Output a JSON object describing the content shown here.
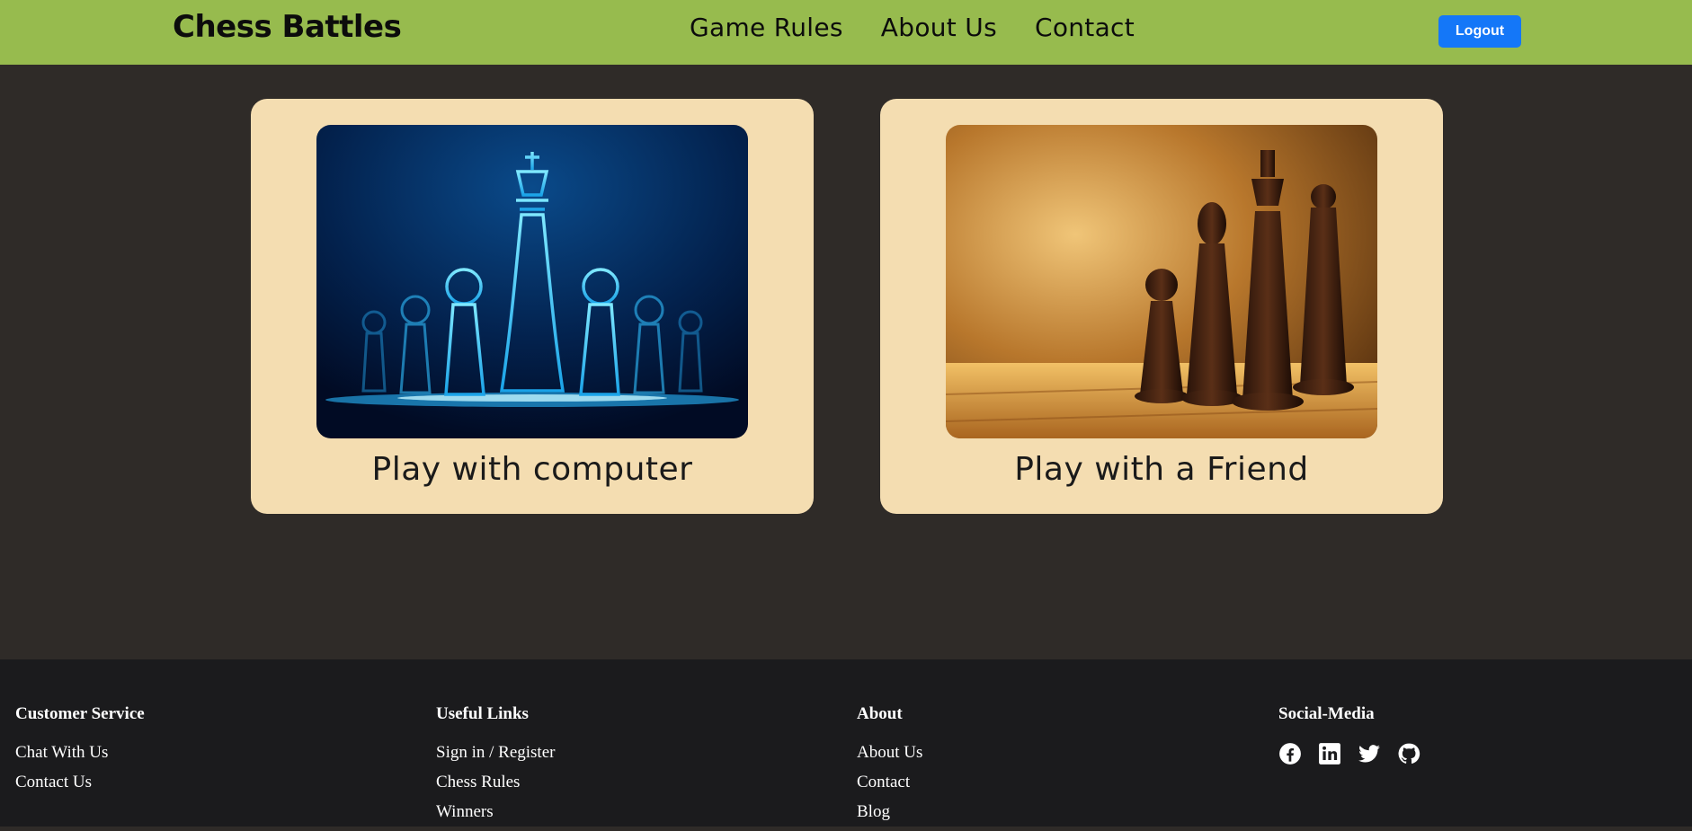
{
  "header": {
    "brand": "Chess Battles",
    "nav": [
      "Game Rules",
      "About Us",
      "Contact"
    ],
    "logout_label": "Logout"
  },
  "cards": [
    {
      "title": "Play with computer",
      "image": "glowing-blue-chess-king-with-pawns"
    },
    {
      "title": "Play with a Friend",
      "image": "wooden-chess-pieces-on-board"
    }
  ],
  "footer": {
    "columns": [
      {
        "heading": "Customer Service",
        "links": [
          "Chat With Us",
          "Contact Us"
        ]
      },
      {
        "heading": "Useful Links",
        "links": [
          "Sign in / Register",
          "Chess Rules",
          "Winners"
        ]
      },
      {
        "heading": "About",
        "links": [
          "About Us",
          "Contact",
          "Blog"
        ]
      },
      {
        "heading": "Social-Media",
        "icons": [
          "facebook-icon",
          "linkedin-icon",
          "twitter-icon",
          "github-icon"
        ]
      }
    ]
  },
  "colors": {
    "header_bg": "#97bb4e",
    "page_bg": "#2f2b28",
    "card_bg": "#f4ddb1",
    "footer_bg": "#1b1b1d",
    "button_bg": "#1477f8"
  }
}
